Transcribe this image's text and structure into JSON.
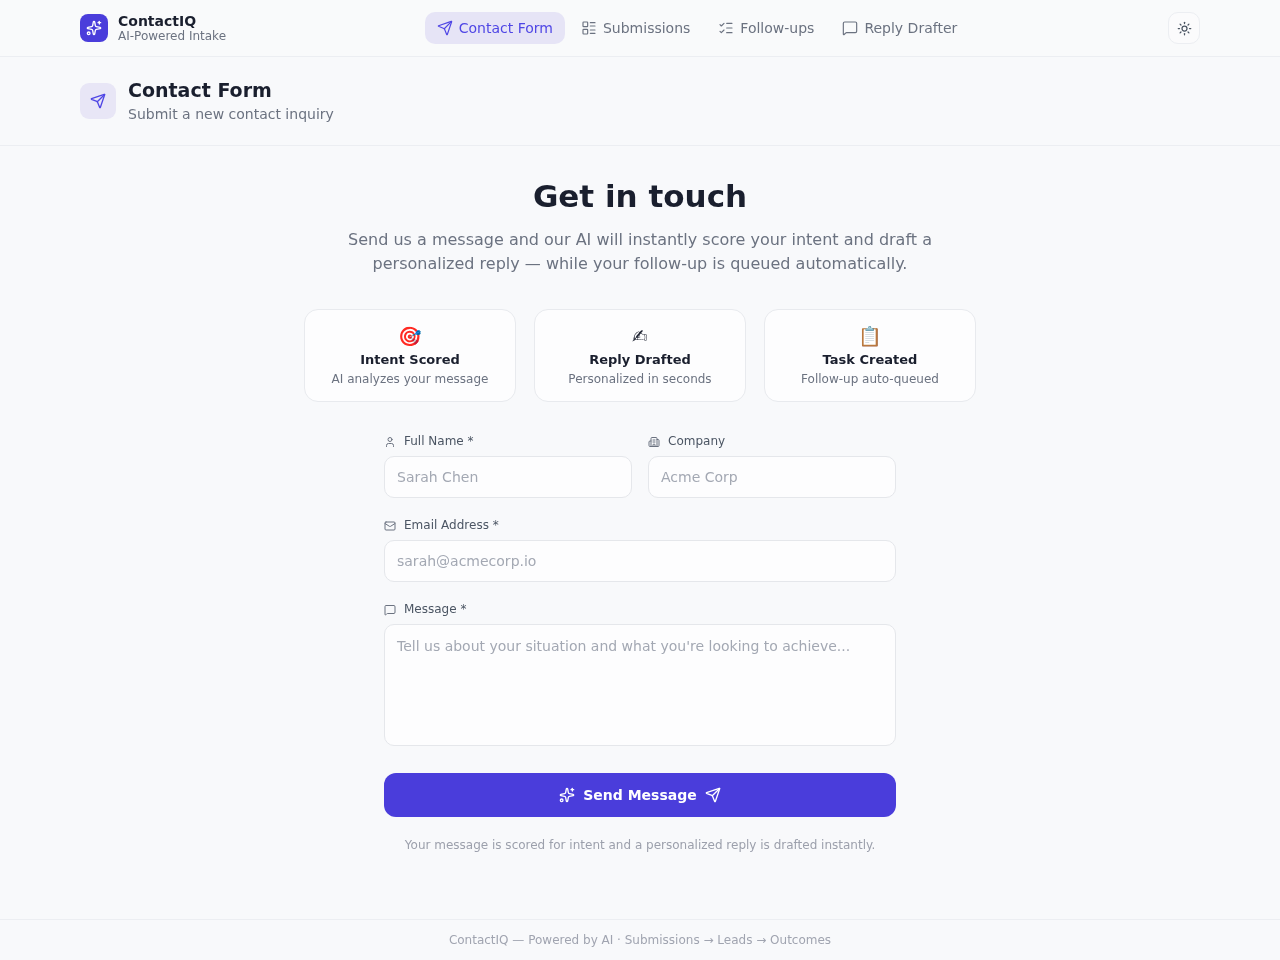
{
  "brand": {
    "name": "ContactIQ",
    "tagline": "AI-Powered Intake"
  },
  "nav": [
    {
      "label": "Contact Form",
      "selected": true
    },
    {
      "label": "Submissions",
      "selected": false
    },
    {
      "label": "Follow-ups",
      "selected": false
    },
    {
      "label": "Reply Drafter",
      "selected": false
    }
  ],
  "page_header": {
    "title": "Contact Form",
    "subtitle": "Submit a new contact inquiry"
  },
  "hero": {
    "title": "Get in touch",
    "subtitle": "Send us a message and our AI will instantly score your intent and draft a personalized reply — while your follow-up is queued automatically."
  },
  "features": [
    {
      "emoji": "🎯",
      "title": "Intent Scored",
      "text": "AI analyzes your message"
    },
    {
      "emoji": "✍",
      "title": "Reply Drafted",
      "text": "Personalized in seconds"
    },
    {
      "emoji": "📋",
      "title": "Task Created",
      "text": "Follow-up auto-queued"
    }
  ],
  "form": {
    "rows": [
      [
        {
          "kind": "text",
          "label": "Full Name *",
          "placeholder": "Sarah Chen"
        },
        {
          "kind": "text",
          "label": "Company",
          "placeholder": "Acme Corp"
        }
      ],
      [
        {
          "kind": "text",
          "label": "Email Address *",
          "placeholder": "sarah@acmecorp.io"
        }
      ],
      [
        {
          "kind": "textarea",
          "label": "Message *",
          "placeholder": "Tell us about your situation and what you're looking to achieve..."
        }
      ]
    ],
    "submit": "Send Message",
    "note": "Your message is scored for intent and a personalized reply is drafted instantly."
  },
  "footer": {
    "text": "ContactIQ — Powered by AI · Submissions → Leads → Outcomes"
  }
}
